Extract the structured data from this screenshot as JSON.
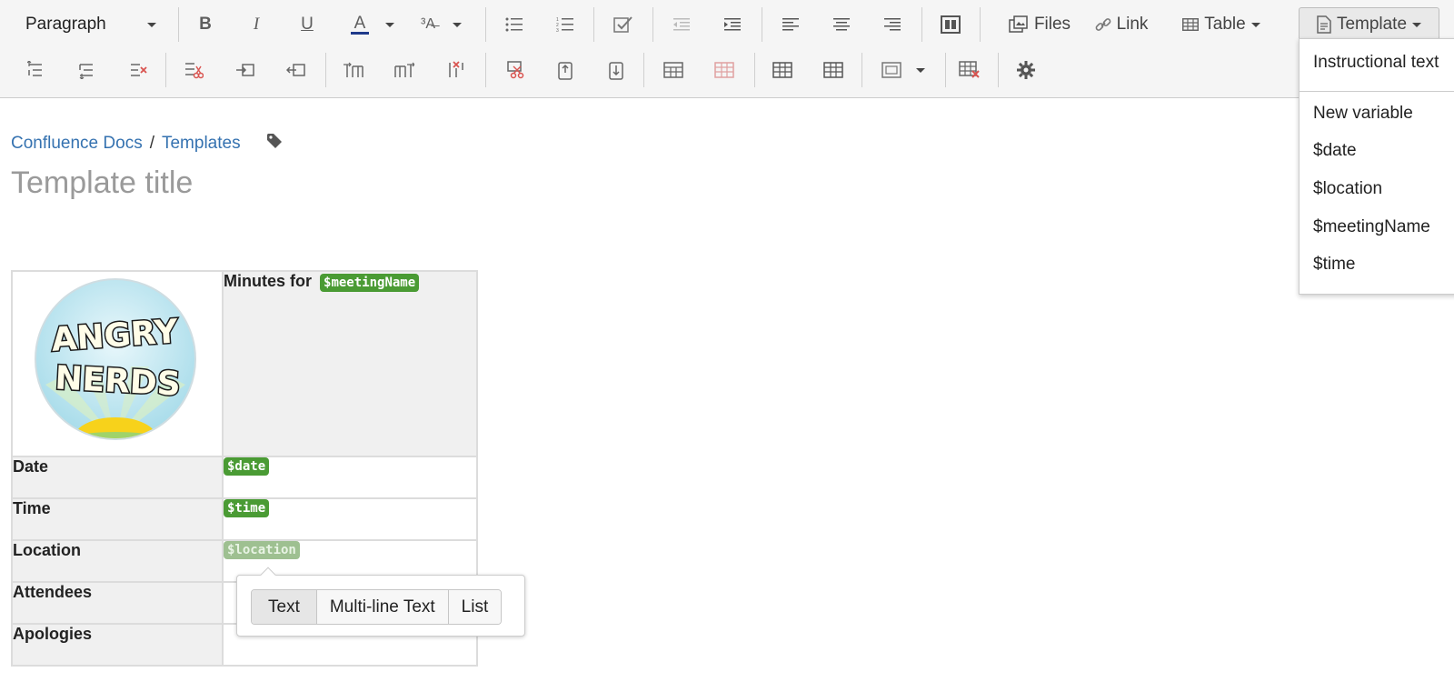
{
  "toolbar": {
    "paragraph_label": "Paragraph",
    "files_label": "Files",
    "link_label": "Link",
    "table_label": "Table",
    "template_label": "Template",
    "text_color_accent": "#1f3a8a"
  },
  "template_menu": {
    "instructional_text": "Instructional text",
    "new_variable": "New variable",
    "variables": [
      "$date",
      "$location",
      "$meetingName",
      "$time"
    ]
  },
  "breadcrumb": {
    "space": "Confluence Docs",
    "separator": "/",
    "parent": "Templates"
  },
  "page": {
    "title_placeholder": "Template title"
  },
  "table": {
    "header_prefix": "Minutes for",
    "header_variable": "$meetingName",
    "logo_text_line1": "ANGRY",
    "logo_text_line2": "NERDS",
    "rows": [
      {
        "label": "Date",
        "variable": "$date"
      },
      {
        "label": "Time",
        "variable": "$time"
      },
      {
        "label": "Location",
        "variable": "$location"
      },
      {
        "label": "Attendees",
        "variable": ""
      },
      {
        "label": "Apologies",
        "variable": ""
      }
    ]
  },
  "variable_type_popup": {
    "options": [
      "Text",
      "Multi-line Text",
      "List"
    ],
    "selected": "Text"
  },
  "colors": {
    "variable_badge": "#4a9b34",
    "link": "#3572b0"
  }
}
